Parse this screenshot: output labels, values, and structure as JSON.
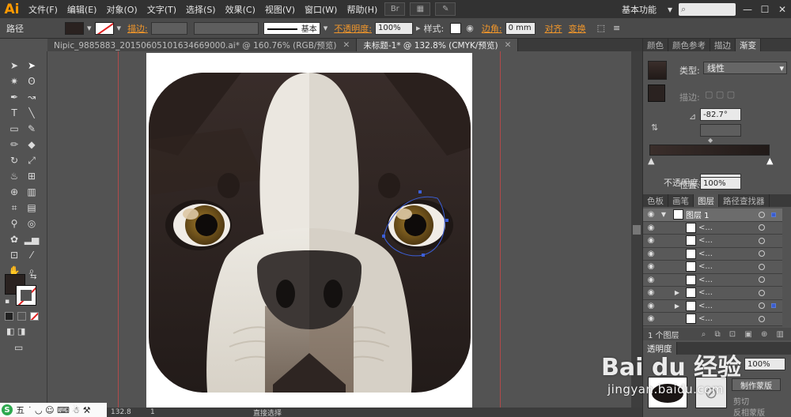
{
  "app": {
    "logo": "Ai",
    "workspace": "基本功能"
  },
  "menu": [
    "文件(F)",
    "编辑(E)",
    "对象(O)",
    "文字(T)",
    "选择(S)",
    "效果(C)",
    "视图(V)",
    "窗口(W)",
    "帮助(H)"
  ],
  "menu_buttons": [
    "Br",
    "▦",
    "✎"
  ],
  "window_controls": [
    "—",
    "☐",
    "✕"
  ],
  "control_bar": {
    "selection_label": "路径",
    "stroke_label": "描边:",
    "stroke_style": "基本",
    "opacity_label": "不透明度:",
    "opacity_value": "100%",
    "style_label": "样式:",
    "corner_label": "边角:",
    "corner_value": "0 mm",
    "align_label": "对齐",
    "transform_label": "变换"
  },
  "doc_tabs": [
    {
      "label": "Nipic_9885883_20150605101634669000.ai* @ 160.76% (RGB/预览)",
      "active": false
    },
    {
      "label": "未标题-1* @ 132.8% (CMYK/预览)",
      "active": true
    }
  ],
  "tab_close": "✕",
  "status": {
    "zoom": "132.8",
    "page": "1",
    "tool": "直接选择"
  },
  "ime": {
    "logo": "S",
    "label": "五",
    "icons": "˙ ◡ ☺ ⌨ ☃ ⚒"
  },
  "gradient_panel": {
    "tabs": [
      "颜色",
      "颜色参考",
      "描边",
      "渐变"
    ],
    "active_tab": 3,
    "type_label": "类型:",
    "type_value": "线性",
    "stroke_label": "描边:",
    "angle_value": "-82.7°",
    "opacity_label": "不透明度:",
    "opacity_value": "100%",
    "position_label": "位置:",
    "position_value": "100%"
  },
  "layers_panel": {
    "tabs": [
      "色板",
      "画笔",
      "图层",
      "路径查找器"
    ],
    "active_tab": 2,
    "layer_name": "图层 1",
    "sublayer_label": "<...",
    "sublayer_count": 8,
    "footer_text": "1 个图层",
    "transparency_tab": "透明度",
    "mask_button": "制作蒙版",
    "clip_label": "剪切",
    "invert_label": "反相蒙版",
    "transparency_value": "100%"
  },
  "colors": {
    "fill": "#2a2220",
    "dog_dark": "#2f2522",
    "dog_light": "#e6e2da",
    "eye_iris": "#7a5a1e",
    "nose": "#3a3533"
  },
  "watermark": {
    "brand": "Bai du 经验",
    "url": "jingyan.baidu.com"
  }
}
